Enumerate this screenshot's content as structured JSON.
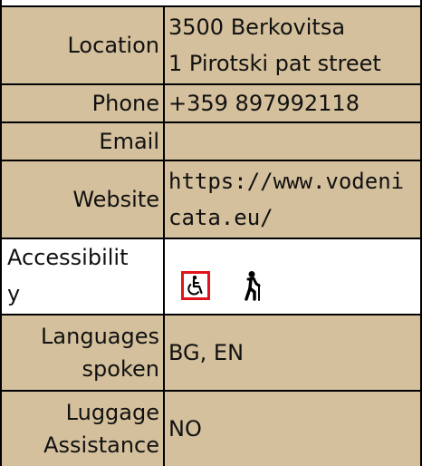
{
  "colors": {
    "row_tan": "#d4c09c",
    "row_white": "#ffffff",
    "border": "#000000",
    "accessible_icon_frame": "#e0141c"
  },
  "info": {
    "location": {
      "label": "Location",
      "line1": "3500 Berkovitsa",
      "line2": "1 Pirotski pat street"
    },
    "phone": {
      "label": "Phone",
      "value": "+359 897992118"
    },
    "email": {
      "label": "Email",
      "value": ""
    },
    "website": {
      "label": "Website",
      "line1": "https://www.vodeni",
      "line2": "cata.eu/"
    },
    "accessibility": {
      "label_line1": "Accessibilit",
      "label_line2": "y",
      "icons": [
        "wheelchair-icon",
        "elderly-person-icon"
      ]
    },
    "languages": {
      "label_line1": "Languages",
      "label_line2": "spoken",
      "value": "BG, EN"
    },
    "luggage": {
      "label_line1": "Luggage",
      "label_line2": "Assistance",
      "value": "NO"
    }
  }
}
